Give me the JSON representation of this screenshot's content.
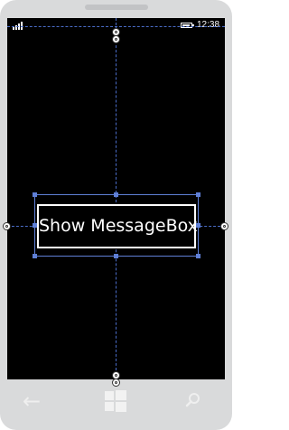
{
  "status_bar": {
    "time": "12:38",
    "signal_icon": "signal-bars-icon",
    "battery_icon": "battery-icon"
  },
  "canvas": {
    "button_label": "Show MessageBox"
  },
  "nav_bar": {
    "back_icon": "back-arrow-icon",
    "start_icon": "windows-logo-icon",
    "search_icon": "search-icon"
  },
  "colors": {
    "screen_background": "#000000",
    "phone_shell": "#d9dadb",
    "guide_line": "#4a6cc7",
    "selection": "#5f7fd6",
    "button_text": "#ffffff"
  }
}
